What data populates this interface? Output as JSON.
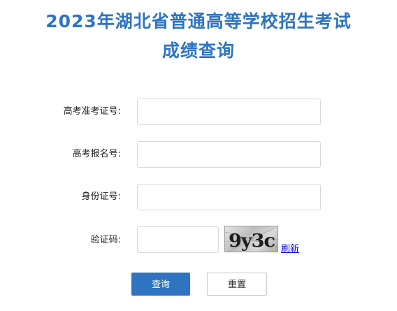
{
  "header": {
    "title_line1": "2023年湖北省普通高等学校招生考试",
    "title_line2": "成绩查询"
  },
  "form": {
    "exam_number_label": "高考准考证号:",
    "exam_number_value": "",
    "registration_number_label": "高考报名号:",
    "registration_number_value": "",
    "id_number_label": "身份证号:",
    "id_number_value": "",
    "captcha_label": "验证码:",
    "captcha_value": "",
    "captcha_image_text": "9y3c",
    "refresh_label": "刷新"
  },
  "actions": {
    "query_label": "查询",
    "reset_label": "重置"
  },
  "colors": {
    "title": "#2e74c1",
    "primary_button": "#2e74c1",
    "link": "#0000ee"
  }
}
